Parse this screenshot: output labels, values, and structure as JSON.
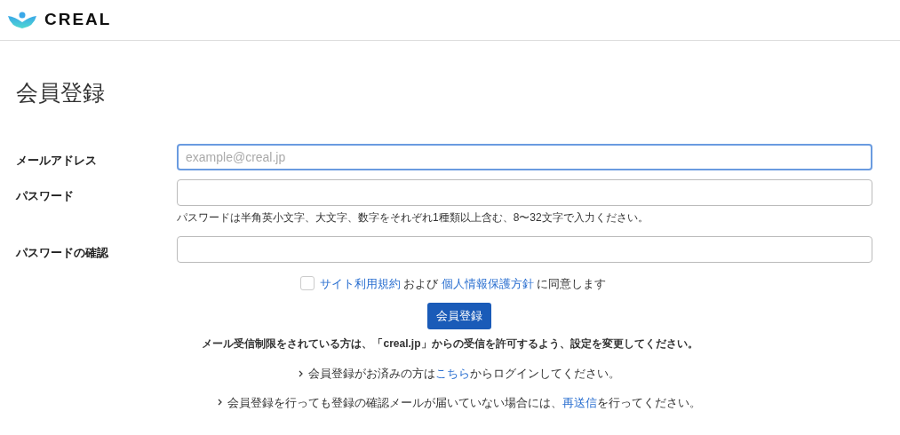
{
  "header": {
    "logo_text": "CREAL"
  },
  "page_title": "会員登録",
  "fields": [
    {
      "label": "メールアドレス",
      "placeholder": "example@creal.jp",
      "focused": true
    },
    {
      "label": "パスワード",
      "focused": false,
      "hint": "パスワードは半角英小文字、大文字、数字をそれぞれ1種類以上含む、8〜32文字で入力ください。"
    },
    {
      "label": "パスワードの確認",
      "focused": false
    }
  ],
  "agreement": {
    "checked": false,
    "parts": [
      {
        "kind": "link",
        "text": "サイト利用規約"
      },
      {
        "kind": "text",
        "text": " および "
      },
      {
        "kind": "link",
        "text": "個人情報保護方針"
      },
      {
        "kind": "text",
        "text": " に同意します"
      }
    ]
  },
  "submit_button": "会員登録",
  "notice": "メール受信制限をされている方は、「creal.jp」からの受信を許可するよう、設定を変更してください。",
  "notes": [
    {
      "parts": [
        {
          "kind": "text",
          "text": "会員登録がお済みの方は"
        },
        {
          "kind": "link",
          "text": "こちら"
        },
        {
          "kind": "text",
          "text": "からログインしてください。"
        }
      ]
    },
    {
      "parts": [
        {
          "kind": "text",
          "text": "会員登録を行っても登録の確認メールが届いていない場合には、"
        },
        {
          "kind": "link",
          "text": "再送信"
        },
        {
          "kind": "text",
          "text": "を行ってください。"
        }
      ]
    }
  ]
}
